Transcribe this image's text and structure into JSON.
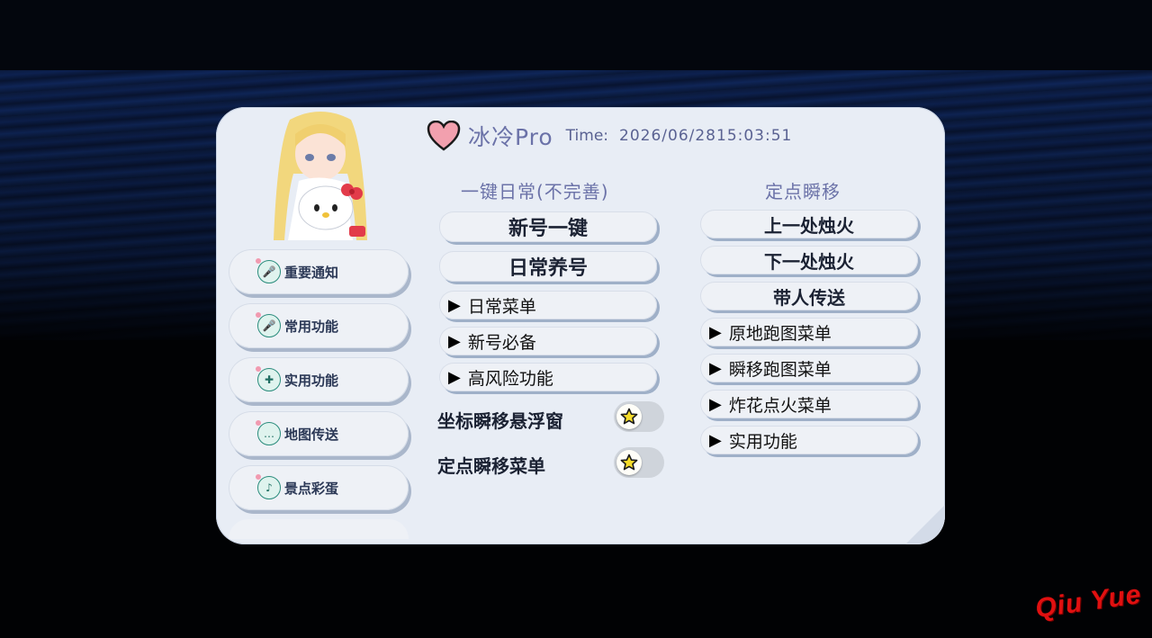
{
  "header": {
    "title": "冰冷Pro",
    "time_label": "Time:",
    "time_value": "2026/06/2815:03:51",
    "heart_color": "#f2a0ae"
  },
  "sidebar": {
    "items": [
      {
        "label": "重要通知",
        "icon": "microphone-icon"
      },
      {
        "label": "常用功能",
        "icon": "microphone-icon"
      },
      {
        "label": "实用功能",
        "icon": "gamepad-icon"
      },
      {
        "label": "地图传送",
        "icon": "chat-bubble-icon"
      },
      {
        "label": "景点彩蛋",
        "icon": "music-note-icon"
      }
    ]
  },
  "left_column": {
    "title": "一键日常(不完善)",
    "buttons": [
      "新号一键",
      "日常养号"
    ],
    "menus": [
      "日常菜单",
      "新号必备",
      "高风险功能"
    ],
    "toggles": [
      {
        "label": "坐标瞬移悬浮窗",
        "on": false
      },
      {
        "label": "定点瞬移菜单",
        "on": false
      }
    ]
  },
  "right_column": {
    "title": "定点瞬移",
    "buttons": [
      "上一处烛火",
      "下一处烛火",
      "带人传送"
    ],
    "menus": [
      "原地跑图菜单",
      "瞬移跑图菜单",
      "炸花点火菜单",
      "实用功能"
    ]
  },
  "menu_arrow": "▶",
  "watermark": "Qiu Yue",
  "colors": {
    "panel": "#e8edf5",
    "accent_text": "#6b72a8",
    "watermark": "#e01010"
  }
}
